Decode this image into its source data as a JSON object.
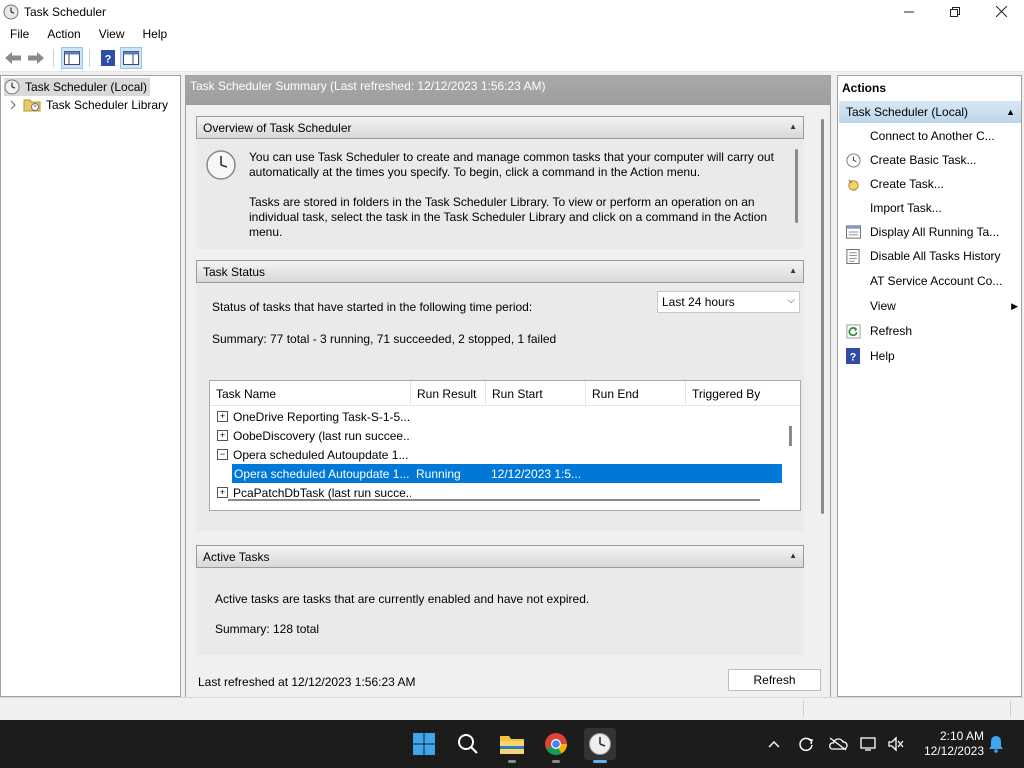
{
  "window": {
    "title": "Task Scheduler"
  },
  "menu": [
    "File",
    "Action",
    "View",
    "Help"
  ],
  "tree": {
    "root": "Task Scheduler (Local)",
    "library": "Task Scheduler Library"
  },
  "center": {
    "header": "Task Scheduler Summary (Last refreshed: 12/12/2023 1:56:23 AM)",
    "overview": {
      "title": "Overview of Task Scheduler",
      "para1": "You can use Task Scheduler to create and manage common tasks that your computer will carry out automatically at the times you specify. To begin, click a command in the Action menu.",
      "para2": "Tasks are stored in folders in the Task Scheduler Library. To view or perform an operation on an individual task, select the task in the Task Scheduler Library and click on a command in the Action menu."
    },
    "task_status": {
      "title": "Task Status",
      "period_label": "Status of tasks that have started in the following time period:",
      "period_value": "Last 24 hours",
      "summary": "Summary: 77 total - 3 running, 71 succeeded, 2 stopped, 1 failed",
      "columns": [
        "Task Name",
        "Run Result",
        "Run Start",
        "Run End",
        "Triggered By"
      ],
      "rows": [
        {
          "expander": "+",
          "name": "OneDrive Reporting Task-S-1-5...",
          "result": "",
          "start": ""
        },
        {
          "expander": "+",
          "name": "OobeDiscovery (last run succee...",
          "result": "",
          "start": ""
        },
        {
          "expander": "−",
          "name": "Opera scheduled Autoupdate 1...",
          "result": "",
          "start": ""
        },
        {
          "expander": "",
          "name": "Opera scheduled Autoupdate 1...",
          "result": "Running",
          "start": "12/12/2023 1:5..."
        },
        {
          "expander": "+",
          "name": "PcaPatchDbTask (last run succe...",
          "result": "",
          "start": ""
        }
      ]
    },
    "active_tasks": {
      "title": "Active Tasks",
      "description": "Active tasks are tasks that are currently enabled and have not expired.",
      "summary": "Summary: 128 total"
    },
    "footer": {
      "last_refreshed": "Last refreshed at 12/12/2023 1:56:23 AM",
      "refresh_label": "Refresh"
    }
  },
  "actions": {
    "title": "Actions",
    "group": "Task Scheduler (Local)",
    "items": [
      "Connect to Another C...",
      "Create Basic Task...",
      "Create Task...",
      "Import Task...",
      "Display All Running Ta...",
      "Disable All Tasks History",
      "AT Service Account Co...",
      "View",
      "Refresh",
      "Help"
    ]
  },
  "taskbar": {
    "time": "2:10 AM",
    "date": "12/12/2023"
  },
  "colors": {
    "selection": "#0078d7",
    "taskbar": "#1c1c1c"
  }
}
